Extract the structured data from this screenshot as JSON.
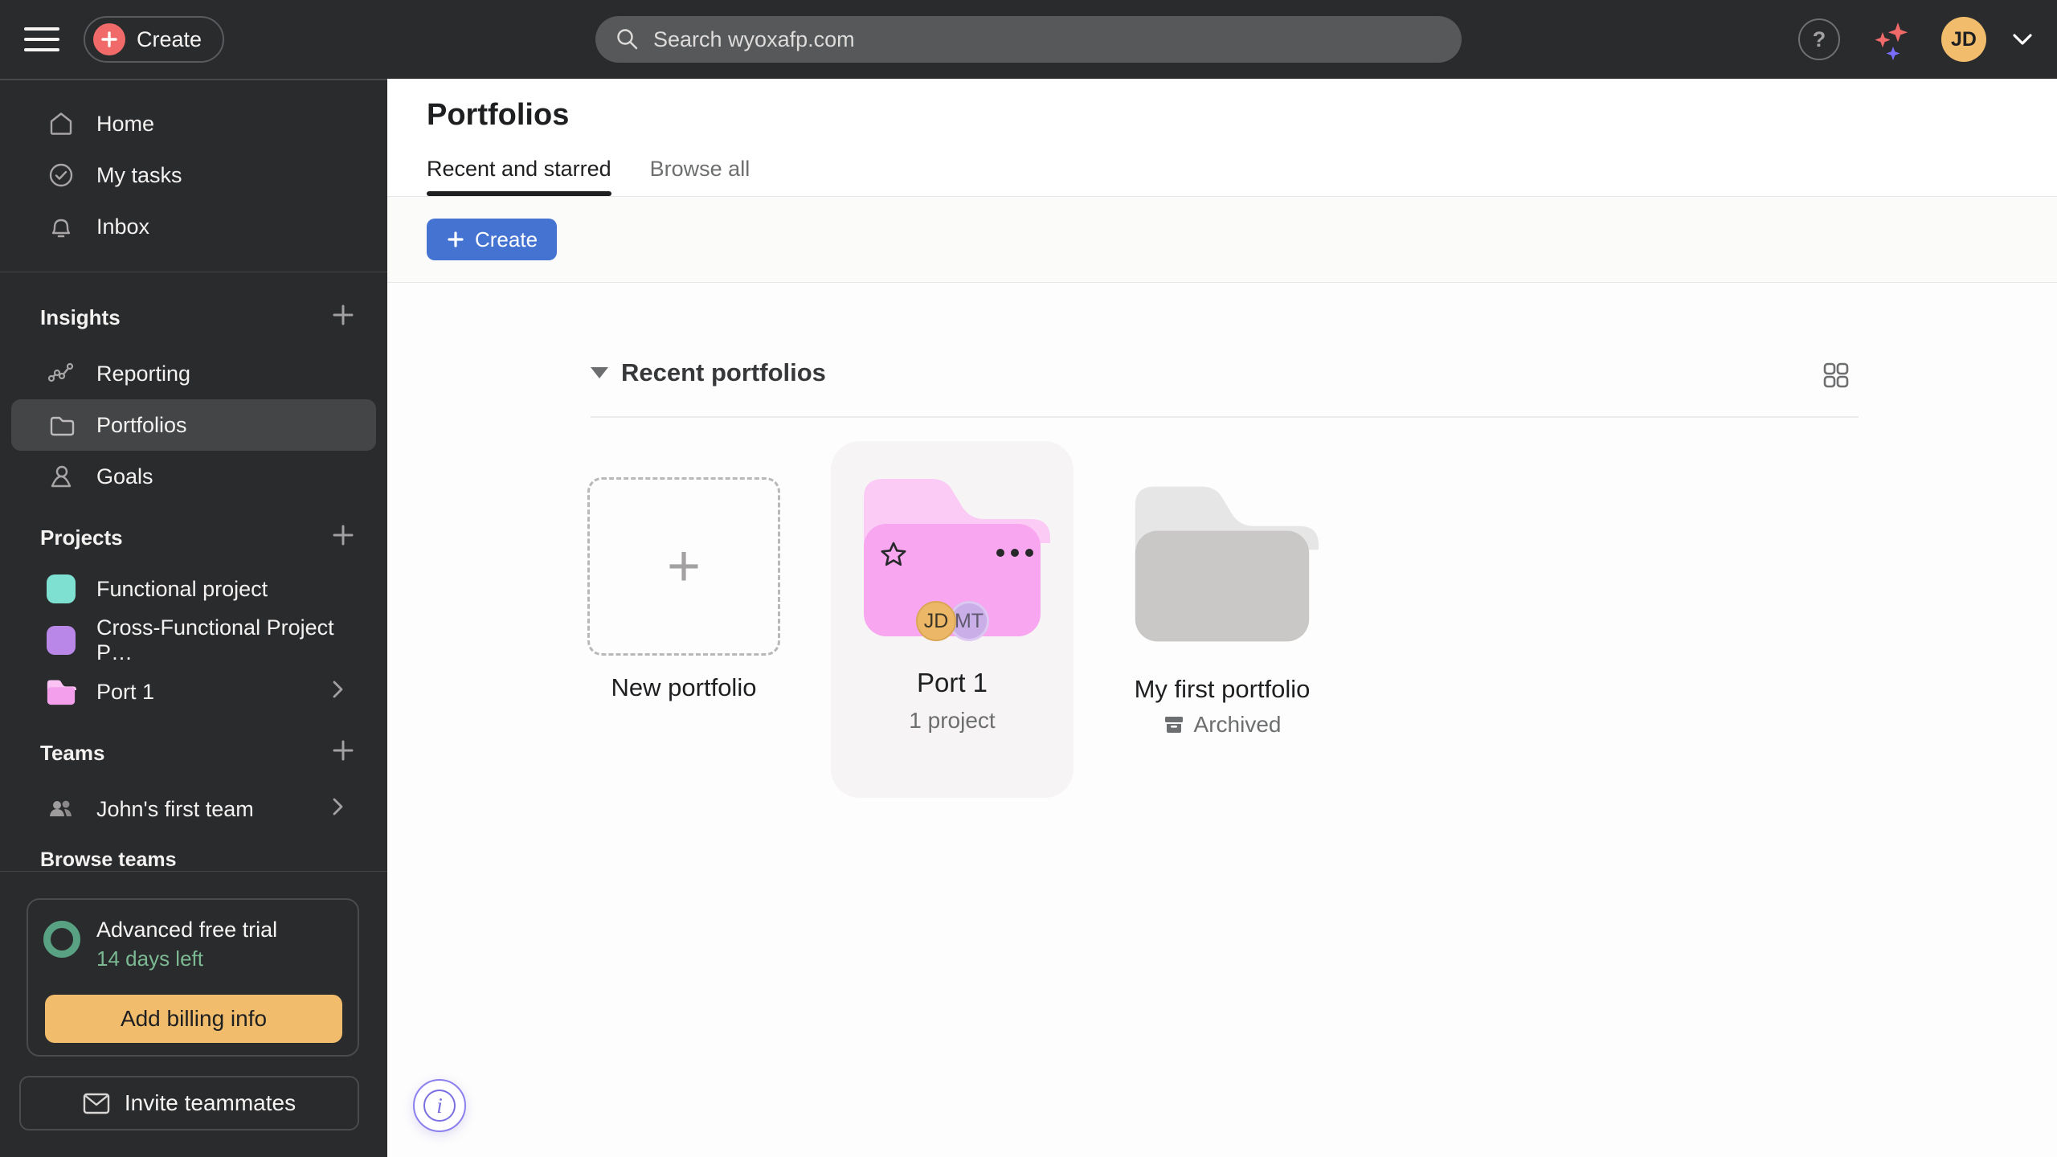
{
  "colors": {
    "topbar_bg": "#2a2b2d",
    "accent_coral": "#f06a6a",
    "accent_blue": "#4573d2",
    "billing_orange": "#f1bd6c",
    "trial_green": "#58a182",
    "folder_pink": "#f7a6ef",
    "folder_pink_tab": "#fbcbf6",
    "folder_gray": "#c9c8c7",
    "folder_gray_tab": "#e7e6e6",
    "swatch_teal": "#7ee0d1",
    "swatch_purple": "#b887e8",
    "avatar_orange": "#f1bd6c",
    "avatar_purple": "#c9aee8",
    "info_purple": "#8b80ee"
  },
  "topbar": {
    "create_label": "Create",
    "search_placeholder": "Search wyoxafp.com",
    "help_glyph": "?",
    "avatar_initials": "JD"
  },
  "sidebar": {
    "nav": [
      {
        "label": "Home"
      },
      {
        "label": "My tasks"
      },
      {
        "label": "Inbox"
      }
    ],
    "insights": {
      "header": "Insights",
      "items": [
        {
          "label": "Reporting"
        },
        {
          "label": "Portfolios"
        },
        {
          "label": "Goals"
        }
      ]
    },
    "projects": {
      "header": "Projects",
      "items": [
        {
          "label": "Functional project"
        },
        {
          "label": "Cross-Functional Project P…"
        },
        {
          "label": "Port 1"
        }
      ]
    },
    "teams": {
      "header": "Teams",
      "items": [
        {
          "label": "John's first team"
        }
      ],
      "browse_label": "Browse teams"
    },
    "trial": {
      "title": "Advanced free trial",
      "remaining": "14 days left",
      "billing_button": "Add billing info"
    },
    "invite_button": "Invite teammates"
  },
  "main": {
    "title": "Portfolios",
    "tabs": [
      {
        "label": "Recent and starred",
        "active": true
      },
      {
        "label": "Browse all",
        "active": false
      }
    ],
    "create_button": "Create",
    "section_title": "Recent portfolios",
    "cards": {
      "new": {
        "label": "New portfolio"
      },
      "port1": {
        "name": "Port 1",
        "meta": "1 project",
        "avatars": [
          "JD",
          "MT"
        ]
      },
      "first": {
        "name": "My first portfolio",
        "status": "Archived"
      }
    },
    "info_glyph": "i"
  }
}
